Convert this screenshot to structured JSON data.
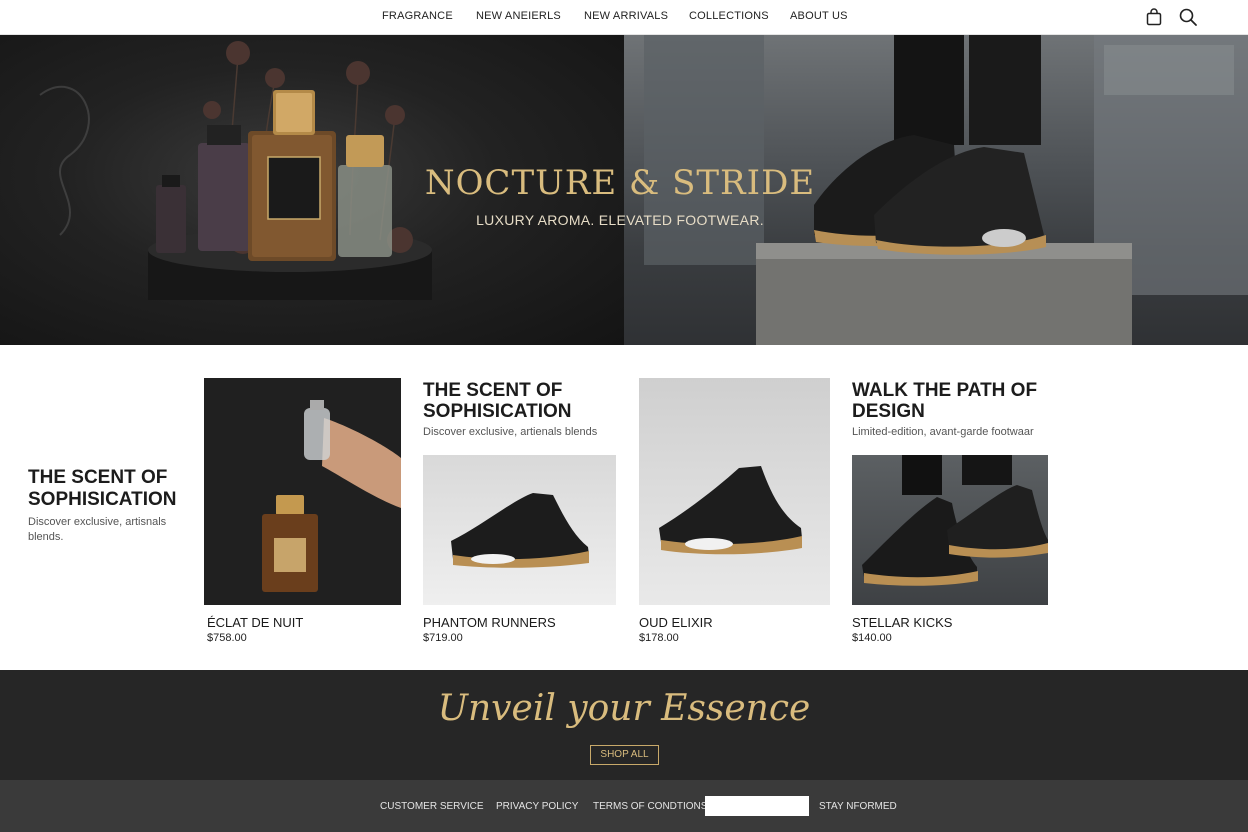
{
  "nav": {
    "links": [
      "FRAGRANCE",
      "NEW ANEIERLS",
      "NEW ARRIVALS",
      "COLLECTIONS",
      "ABOUT US"
    ],
    "icons": [
      "shopping-bag-icon",
      "search-icon"
    ]
  },
  "hero": {
    "title": "NOCTURE & STRIDE",
    "subtitle": "LUXURY AROMA. ELEVATED FOOTWEAR."
  },
  "side_promo": {
    "heading": "THE SCENT OF SOPHISICATION",
    "description": "Discover exclusive, artisnals blends."
  },
  "promos": [
    {
      "heading": "THE SCENT OF SOPHISICATION",
      "description": "Discover exclusive, artienals blends"
    },
    {
      "heading": "WALK THE PATH OF DESIGN",
      "description": "Limited-edition, avant-garde footwaar"
    }
  ],
  "products": [
    {
      "name": "ÉCLAT DE NUIT",
      "price": "$758.00"
    },
    {
      "name": "PHANTOM RUNNERS",
      "price": "$719.00"
    },
    {
      "name": "OUD ELIXIR",
      "price": "$178.00"
    },
    {
      "name": "STELLAR KICKS",
      "price": "$140.00"
    }
  ],
  "cta": {
    "script": "Unveil your Essence",
    "button": "SHOP ALL"
  },
  "footer": {
    "links": [
      "CUSTOMER SERVICE",
      "PRIVACY POLICY",
      "TERMS OF CONDTIONS"
    ],
    "newsletter_value": "",
    "stay_label": "STAY NFORMED"
  },
  "colors": {
    "gold": "#d9bc7e",
    "dark": "#262626",
    "footer": "#3a3a3a"
  }
}
